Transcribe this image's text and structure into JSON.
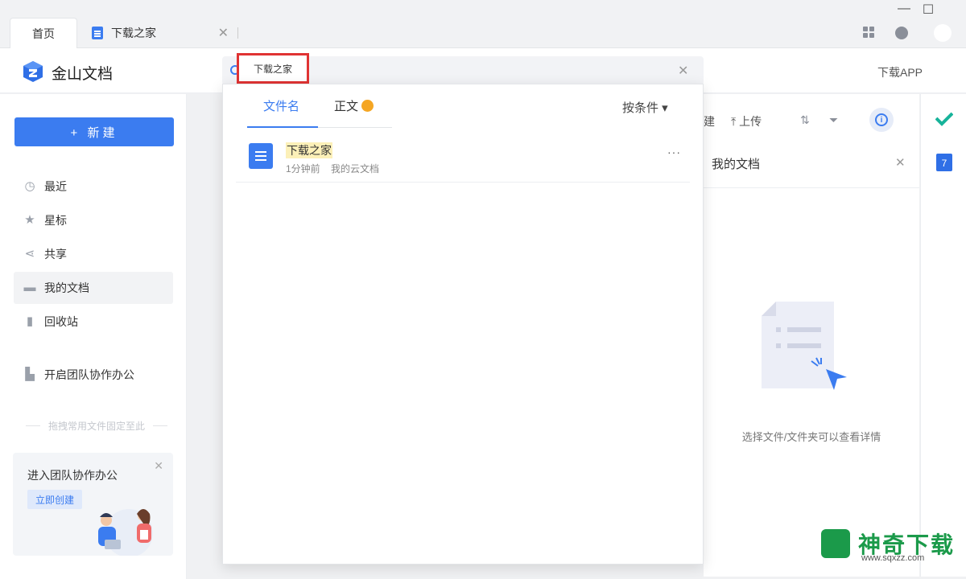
{
  "window": {
    "tabs": [
      {
        "label": "首页"
      },
      {
        "label": "下载之家"
      }
    ],
    "controls": {
      "minimize": "—",
      "maximize": "☐"
    }
  },
  "header": {
    "app_title": "金山文档",
    "download_app": "下载APP"
  },
  "search": {
    "query_chip": "下载之家",
    "dropdown": {
      "tabs": [
        {
          "label": "文件名",
          "active": true
        },
        {
          "label": "正文",
          "active": false
        }
      ],
      "filter_label": "按条件 ▾",
      "results": [
        {
          "name": "下载之家",
          "time": "1分钟前",
          "location": "我的云文档",
          "more": "···"
        }
      ]
    }
  },
  "sidebar": {
    "new_button": "+ 新建",
    "items": [
      {
        "label": "最近",
        "icon": "clock-icon"
      },
      {
        "label": "星标",
        "icon": "star-icon"
      },
      {
        "label": "共享",
        "icon": "share-icon"
      },
      {
        "label": "我的文档",
        "icon": "folder-icon",
        "active": true
      },
      {
        "label": "回收站",
        "icon": "trash-icon"
      },
      {
        "label": "开启团队协作办公",
        "icon": "building-icon"
      }
    ],
    "pin_hint": "拖拽常用文件固定至此",
    "promo": {
      "title": "进入团队协作办公",
      "button": "立即创建"
    }
  },
  "toolbar": {
    "new_partial": "建",
    "upload": "上传"
  },
  "details": {
    "title": "我的文档",
    "empty_text": "选择文件/文件夹可以查看详情"
  },
  "watermark": {
    "text": "神奇下载",
    "url": "www.sqxzz.com"
  },
  "colors": {
    "accent": "#3b7cf0",
    "highlight": "#fcf0b8",
    "red_box": "#e03333",
    "watermark_green": "#1b9a4a"
  }
}
